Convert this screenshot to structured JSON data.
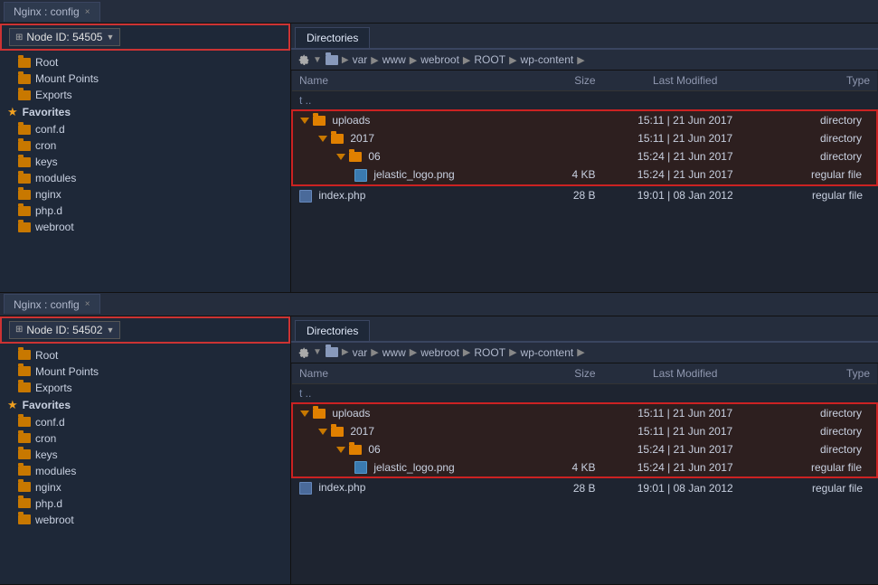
{
  "panels": [
    {
      "id": "panel1",
      "tab_label": "Nginx : config",
      "sidebar": {
        "node_id": "Node ID: 54505",
        "items": [
          {
            "label": "Root",
            "indent": 1,
            "type": "folder"
          },
          {
            "label": "Mount Points",
            "indent": 1,
            "type": "folder"
          },
          {
            "label": "Exports",
            "indent": 1,
            "type": "folder"
          },
          {
            "label": "Favorites",
            "indent": 0,
            "type": "star"
          },
          {
            "label": "conf.d",
            "indent": 1,
            "type": "folder"
          },
          {
            "label": "cron",
            "indent": 1,
            "type": "folder"
          },
          {
            "label": "keys",
            "indent": 1,
            "type": "folder"
          },
          {
            "label": "modules",
            "indent": 1,
            "type": "folder"
          },
          {
            "label": "nginx",
            "indent": 1,
            "type": "folder"
          },
          {
            "label": "php.d",
            "indent": 1,
            "type": "folder"
          },
          {
            "label": "webroot",
            "indent": 1,
            "type": "folder"
          }
        ]
      },
      "directories": {
        "tab_label": "Directories",
        "breadcrumb": [
          "var",
          "www",
          "webroot",
          "ROOT",
          "wp-content"
        ],
        "columns": [
          "Name",
          "Size",
          "Last Modified",
          "Type"
        ],
        "rows": [
          {
            "name": "..",
            "size": "",
            "modified": "",
            "type": "",
            "kind": "parent",
            "indent": 0
          },
          {
            "name": "uploads",
            "size": "",
            "modified": "15:11 | 21 Jun 2017",
            "type": "directory",
            "kind": "folder-hl",
            "indent": 0,
            "expanded": true
          },
          {
            "name": "2017",
            "size": "",
            "modified": "15:11 | 21 Jun 2017",
            "type": "directory",
            "kind": "folder-hl",
            "indent": 1,
            "expanded": true
          },
          {
            "name": "06",
            "size": "",
            "modified": "15:24 | 21 Jun 2017",
            "type": "directory",
            "kind": "folder-hl",
            "indent": 2,
            "expanded": true
          },
          {
            "name": "jelastic_logo.png",
            "size": "4 KB",
            "modified": "15:24 | 21 Jun 2017",
            "type": "regular file",
            "kind": "file-img-hl",
            "indent": 3
          },
          {
            "name": "index.php",
            "size": "28 B",
            "modified": "19:01 | 08 Jan 2012",
            "type": "regular file",
            "kind": "file-php",
            "indent": 0
          }
        ]
      }
    },
    {
      "id": "panel2",
      "tab_label": "Nginx : config",
      "sidebar": {
        "node_id": "Node ID: 54502",
        "items": [
          {
            "label": "Root",
            "indent": 1,
            "type": "folder"
          },
          {
            "label": "Mount Points",
            "indent": 1,
            "type": "folder"
          },
          {
            "label": "Exports",
            "indent": 1,
            "type": "folder"
          },
          {
            "label": "Favorites",
            "indent": 0,
            "type": "star"
          },
          {
            "label": "conf.d",
            "indent": 1,
            "type": "folder"
          },
          {
            "label": "cron",
            "indent": 1,
            "type": "folder"
          },
          {
            "label": "keys",
            "indent": 1,
            "type": "folder"
          },
          {
            "label": "modules",
            "indent": 1,
            "type": "folder"
          },
          {
            "label": "nginx",
            "indent": 1,
            "type": "folder"
          },
          {
            "label": "php.d",
            "indent": 1,
            "type": "folder"
          },
          {
            "label": "webroot",
            "indent": 1,
            "type": "folder"
          }
        ]
      },
      "directories": {
        "tab_label": "Directories",
        "breadcrumb": [
          "var",
          "www",
          "webroot",
          "ROOT",
          "wp-content"
        ],
        "columns": [
          "Name",
          "Size",
          "Last Modified",
          "Type"
        ],
        "rows": [
          {
            "name": "..",
            "size": "",
            "modified": "",
            "type": "",
            "kind": "parent",
            "indent": 0
          },
          {
            "name": "uploads",
            "size": "",
            "modified": "15:11 | 21 Jun 2017",
            "type": "directory",
            "kind": "folder-hl",
            "indent": 0,
            "expanded": true
          },
          {
            "name": "2017",
            "size": "",
            "modified": "15:11 | 21 Jun 2017",
            "type": "directory",
            "kind": "folder-hl",
            "indent": 1,
            "expanded": true
          },
          {
            "name": "06",
            "size": "",
            "modified": "15:24 | 21 Jun 2017",
            "type": "directory",
            "kind": "folder-hl",
            "indent": 2,
            "expanded": true
          },
          {
            "name": "jelastic_logo.png",
            "size": "4 KB",
            "modified": "15:24 | 21 Jun 2017",
            "type": "regular file",
            "kind": "file-img-hl",
            "indent": 3
          },
          {
            "name": "index.php",
            "size": "28 B",
            "modified": "19:01 | 08 Jan 2012",
            "type": "regular file",
            "kind": "file-php",
            "indent": 0
          }
        ]
      }
    }
  ]
}
